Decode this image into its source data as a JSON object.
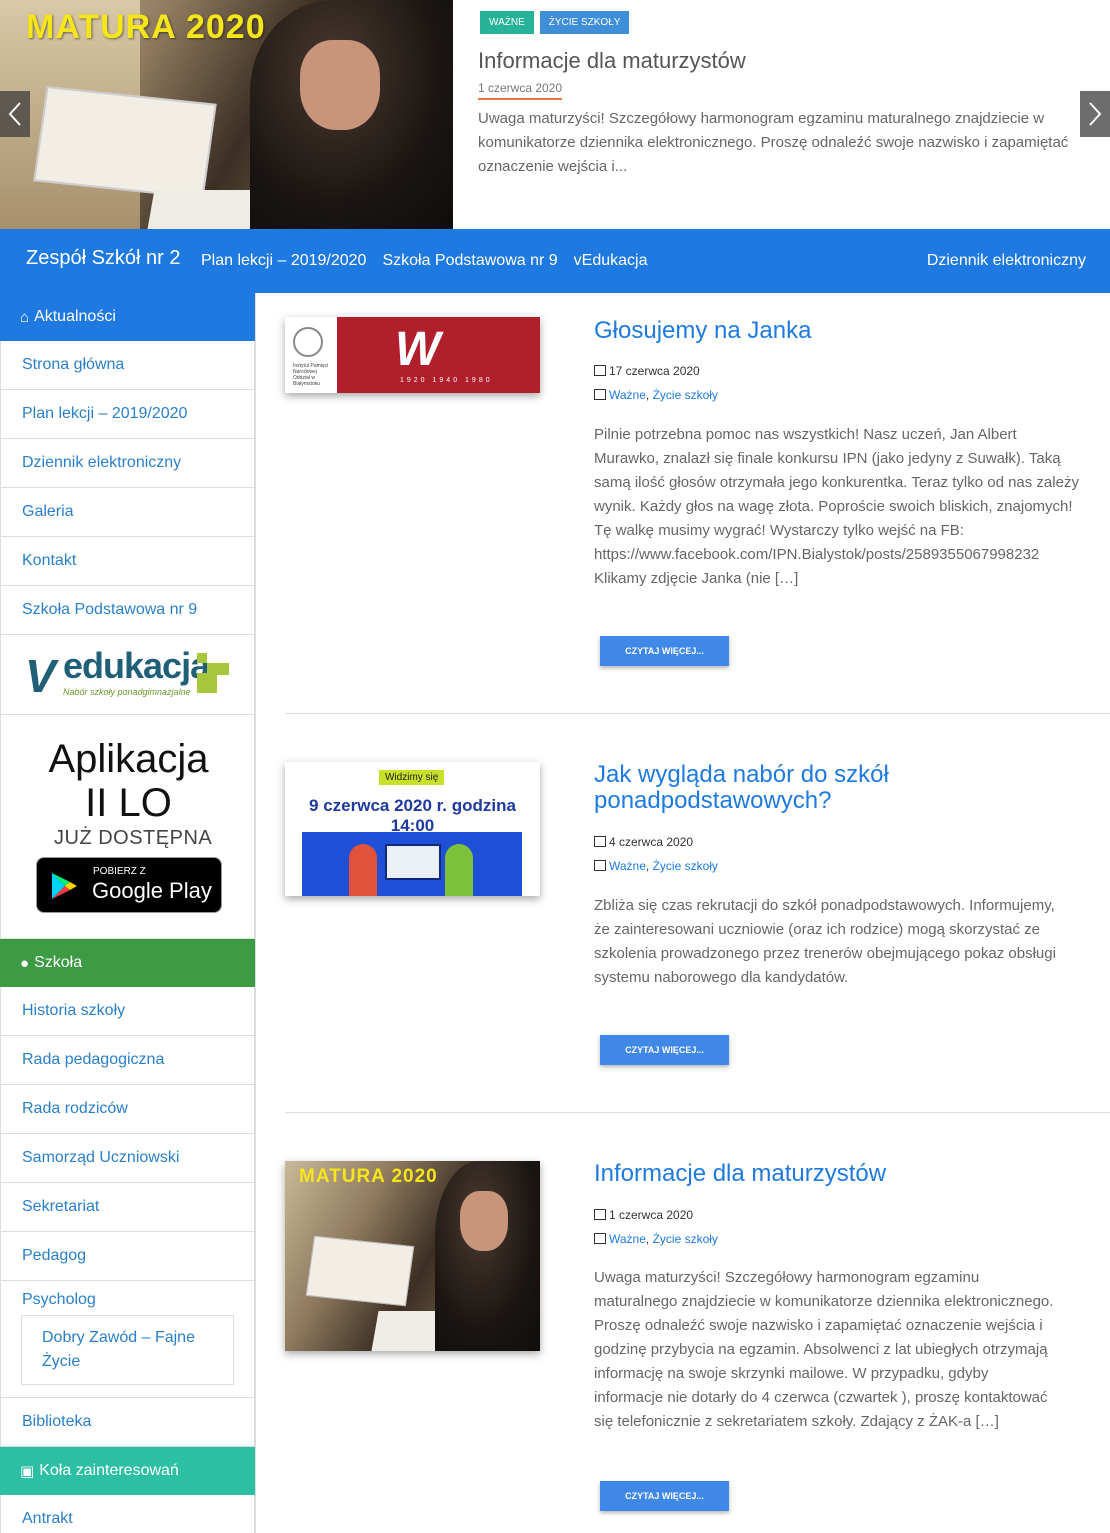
{
  "hero": {
    "image_caption": "MATURA 2020",
    "tags": [
      "WAŻNE",
      "ŻYCIE SZKOŁY"
    ],
    "title": "Informacje dla maturzystów",
    "date": "1 czerwca 2020",
    "excerpt": "Uwaga maturzyści! Szczegółowy harmonogram egzaminu maturalnego znajdziecie w komunikatorze dziennika elektronicznego. Proszę odnaleźć swoje nazwisko i zapamiętać oznaczenie wejścia i..."
  },
  "navbar": {
    "brand": "Zespół Szkół nr 2",
    "items": [
      "Plan lekcji – 2019/2020",
      "Szkoła Podstawowa nr 9",
      "vEdukacja"
    ],
    "right": "Dziennik elektroniczny",
    "color": "#1e7ae0"
  },
  "sidebar": {
    "section1": {
      "title": "Aktualności",
      "items": [
        "Strona główna",
        "Plan lekcji – 2019/2020",
        "Dziennik elektroniczny",
        "Galeria",
        "Kontakt",
        "Szkoła Podstawowa nr 9"
      ]
    },
    "vedukacja": {
      "letter": "V",
      "word": "edukacja",
      "sub": "Nabór szkoły ponadgimnazjalne"
    },
    "app": {
      "line1": "Aplikacja",
      "line2": "II LO",
      "line3": "JUŻ DOSTĘPNA",
      "badge_small": "POBIERZ Z",
      "badge_big": "Google Play"
    },
    "section2": {
      "title": "Szkoła",
      "items": [
        "Historia szkoły",
        "Rada pedagogiczna",
        "Rada rodziców",
        "Samorząd Uczniowski",
        "Sekretariat",
        "Pedagog"
      ],
      "psychology": "Psycholog",
      "sub_item": "Dobry Zawód – Fajne Życie",
      "after": "Biblioteka"
    },
    "section3": {
      "title": "Koła zainteresowań",
      "items": [
        "Antrakt"
      ]
    }
  },
  "posts": [
    {
      "title": "Głosujemy na Janka",
      "date": "17 czerwca 2020",
      "cat1": "Ważne",
      "cat2": "Życie szkoły",
      "excerpt": "Pilnie potrzebna pomoc nas wszystkich! Nasz uczeń, Jan Albert Murawko, znalazł się finale konkursu IPN (jako jedyny z Suwałk). Taką samą ilość głosów otrzymała jego konkurentka. Teraz tylko od nas zależy wynik. Każdy głos na wagę złota. Poproście swoich bliskich, znajomych! Tę walkę musimy wygrać! Wystarczy tylko wejść na FB: https://www.facebook.com/IPN.Bialystok/posts/2589355067998232 Klikamy zdjęcie Janka (nie […]",
      "button": "CZYTAJ WIĘCEJ...",
      "thumb": {
        "org": "Instytut Pamięci Narodowej Oddział w Białymstoku",
        "letter": "W",
        "years": "1920 1940 1980"
      }
    },
    {
      "title": "Jak wygląda nabór do szkół ponadpodstawowych?",
      "date": "4 czerwca 2020",
      "cat1": "Ważne",
      "cat2": "Życie szkoły",
      "excerpt": "Zbliża się czas rekrutacji do szkół ponadpodstawowych. Informujemy, że zainteresowani uczniowie (oraz ich rodzice) mogą skorzystać ze szkolenia prowadzonego przez trenerów obejmującego pokaz obsługi systemu naborowego dla kandydatów.",
      "button": "CZYTAJ WIĘCEJ...",
      "thumb": {
        "pill": "Widzimy się",
        "headline": "9 czerwca 2020 r. godzina 14:00"
      }
    },
    {
      "title": "Informacje dla maturzystów",
      "date": "1 czerwca 2020",
      "cat1": "Ważne",
      "cat2": "Życie szkoły",
      "excerpt": "Uwaga maturzyści! Szczegółowy harmonogram egzaminu maturalnego znajdziecie w komunikatorze dziennika elektronicznego. Proszę odnaleźć swoje nazwisko i zapamiętać oznaczenie wejścia i godzinę przybycia na egzamin. Absolwenci z lat ubiegłych otrzymają informację na swoje skrzynki mailowe. W przypadku, gdyby informacje nie dotarły do 4 czerwca (czwartek ), proszę kontaktować się telefonicznie z sekretariatem szkoły. Zdający z ŻAK-a […]",
      "button": "CZYTAJ WIĘCEJ...",
      "thumb": {
        "caption": "MATURA 2020"
      }
    }
  ]
}
